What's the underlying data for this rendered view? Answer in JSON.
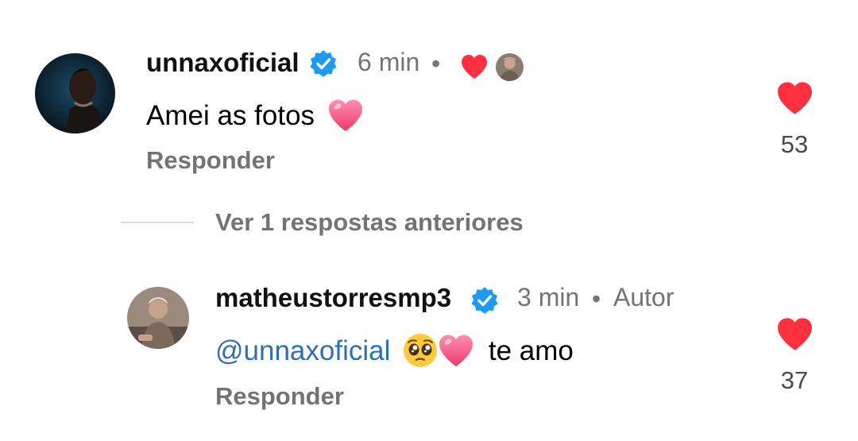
{
  "comments": [
    {
      "username": "unnaxoficial",
      "time": "6 min",
      "text": "Amei as fotos",
      "reply_label": "Responder",
      "likes": "53",
      "liked_by_author": true
    },
    {
      "username": "matheustorresmp3",
      "time": "3 min",
      "author_badge": "Autor",
      "mention": "@unnaxoficial",
      "text": "te amo",
      "reply_label": "Responder",
      "likes": "37"
    }
  ],
  "view_previous_replies": "Ver 1 respostas anteriores",
  "colors": {
    "like_red": "#ff3040",
    "verified_blue": "#1d9bf0",
    "mention_blue": "#2f6fb3",
    "meta_gray": "#73737a"
  },
  "icons": [
    "verified-badge-icon",
    "heart-icon",
    "pink-heart-emoji",
    "pleading-face-emoji"
  ]
}
